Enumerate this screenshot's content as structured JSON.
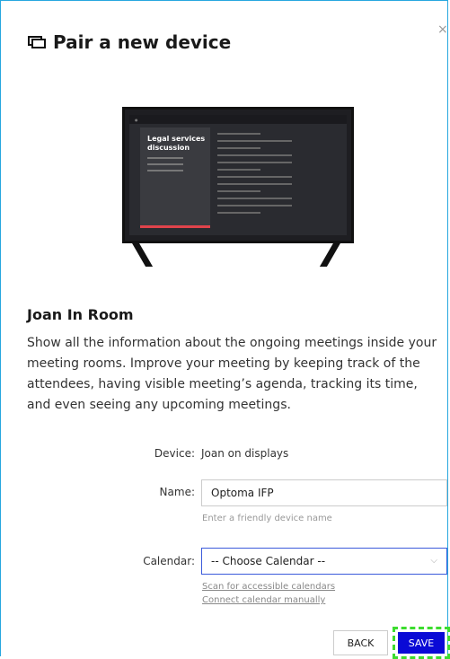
{
  "dialog": {
    "title": "Pair a new device",
    "close_label": "×"
  },
  "product": {
    "name": "Joan In Room",
    "description": "Show all the information about the ongoing meetings inside your meeting rooms. Improve your meeting by keeping track of the attendees, having visible meeting’s agenda, tracking its time, and even seeing any upcoming meetings."
  },
  "illustration": {
    "meeting_title": "Legal services discussion"
  },
  "form": {
    "device_label": "Device:",
    "device_value": "Joan on displays",
    "name_label": "Name:",
    "name_value": "Optoma IFP",
    "name_hint": "Enter a friendly device name",
    "calendar_label": "Calendar:",
    "calendar_value": "-- Choose Calendar --",
    "scan_link": "Scan for accessible calendars",
    "connect_link": "Connect calendar manually"
  },
  "buttons": {
    "back": "BACK",
    "save": "SAVE"
  },
  "colors": {
    "border": "#27a7df",
    "save_bg": "#0a0ad6",
    "focus": "#3b5bdb",
    "highlight": "#3ddc2f"
  }
}
